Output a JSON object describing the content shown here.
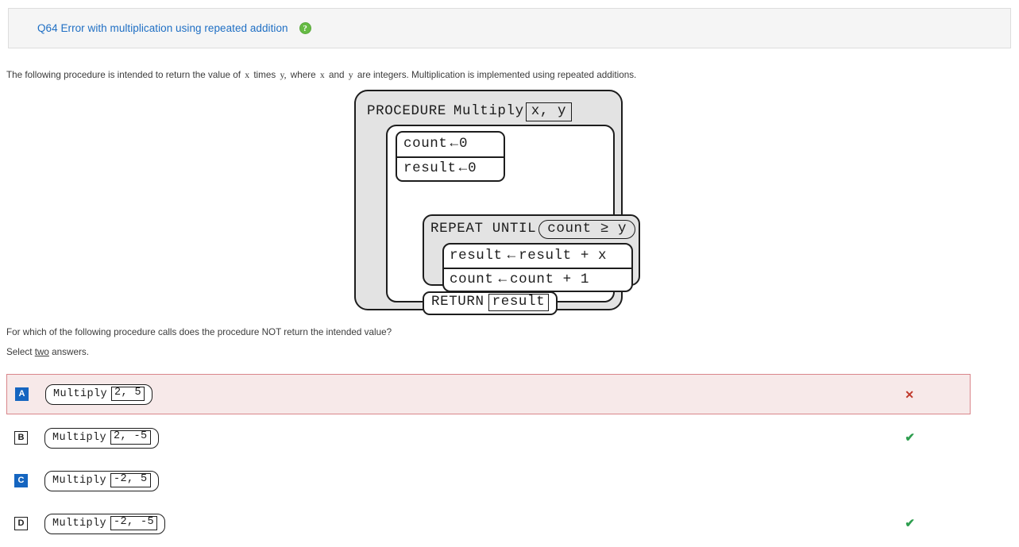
{
  "header": {
    "title": "Q64 Error with multiplication using repeated addition",
    "help_icon": "help-circle-icon",
    "help_glyph": "?",
    "background": "#f5f5f5",
    "title_color": "#1f6fc4",
    "help_color": "#66bb44"
  },
  "prompt": {
    "part1": "The following procedure is intended to return the value of",
    "var_x": "x",
    "times": "times",
    "var_y": "y,",
    "part2": "where",
    "var_x2": "x",
    "and": "and",
    "var_y2": "y",
    "part3": "are integers. Multiplication is implemented using repeated additions."
  },
  "pseudocode": {
    "procedure_keyword": "PROCEDURE",
    "procedure_name": "Multiply",
    "parameters": "x, y",
    "init": [
      {
        "target": "count",
        "arrow": "←",
        "value": "0"
      },
      {
        "target": "result",
        "arrow": "←",
        "value": "0"
      }
    ],
    "repeat_keyword": "REPEAT UNTIL",
    "repeat_condition": "count ≥ y",
    "loop_body": [
      {
        "target": "result",
        "arrow": "←",
        "value": "result + x"
      },
      {
        "target": "count",
        "arrow": "←",
        "value": "count + 1"
      }
    ],
    "return_keyword": "RETURN",
    "return_value": "result"
  },
  "question": {
    "text": "For which of the following procedure calls does the procedure NOT return the intended value?",
    "instruction_pre": "Select ",
    "instruction_emphasis": "two",
    "instruction_post": " answers."
  },
  "answers": [
    {
      "letter": "A",
      "call_name": "Multiply",
      "arguments": "2, 5",
      "selected": true,
      "mark": "✕",
      "mark_type": "cross",
      "mark_color": "#c0392b",
      "row_state": "incorrect-selected"
    },
    {
      "letter": "B",
      "call_name": "Multiply",
      "arguments": "2, -5",
      "selected": false,
      "mark": "✔",
      "mark_type": "check",
      "mark_color": "#2e9e4f",
      "row_state": "correct-unselected"
    },
    {
      "letter": "C",
      "call_name": "Multiply",
      "arguments": "-2, 5",
      "selected": true,
      "mark": "",
      "mark_type": "none",
      "mark_color": "",
      "row_state": "selected"
    },
    {
      "letter": "D",
      "call_name": "Multiply",
      "arguments": "-2, -5",
      "selected": false,
      "mark": "✔",
      "mark_type": "check",
      "mark_color": "#2e9e4f",
      "row_state": "correct-unselected"
    }
  ]
}
